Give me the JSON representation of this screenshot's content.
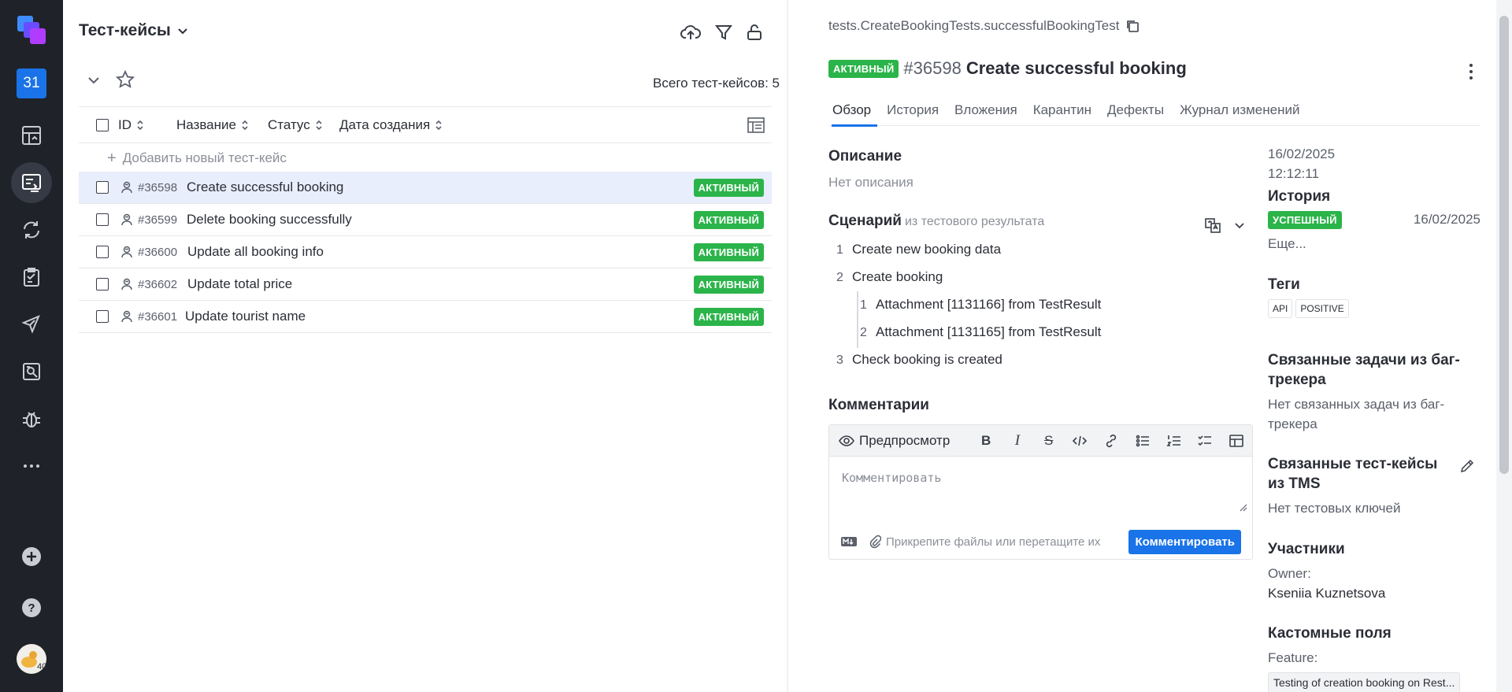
{
  "rail": {
    "project_label": "31",
    "nav_icons": [
      "dashboard-icon",
      "test-cases-icon",
      "launches-icon",
      "test-plans-icon",
      "jobs-icon",
      "analytics-icon",
      "defects-icon",
      "more-icon"
    ],
    "bottom_icons": [
      "add-project-icon",
      "help-icon",
      "avatar"
    ],
    "avatar_badge": "40"
  },
  "list": {
    "title": "Тест-кейсы",
    "total_label": "Всего тест-кейсов: 5",
    "columns": [
      "ID",
      "Название",
      "Статус",
      "Дата создания"
    ],
    "add_label": "Добавить новый тест-кейс",
    "rows": [
      {
        "id": "#36598",
        "name": "Create successful booking",
        "status": "АКТИВНЫЙ",
        "selected": true
      },
      {
        "id": "#36599",
        "name": "Delete booking successfully",
        "status": "АКТИВНЫЙ"
      },
      {
        "id": "#36600",
        "name": "Update all booking info",
        "status": "АКТИВНЫЙ"
      },
      {
        "id": "#36602",
        "name": "Update total price",
        "status": "АКТИВНЫЙ"
      },
      {
        "id": "#36601",
        "name": "Update tourist name",
        "status": "АКТИВНЫЙ"
      }
    ]
  },
  "detail": {
    "path": "tests.CreateBookingTests.successfulBookingTest",
    "status": "АКТИВНЫЙ",
    "number": "#36598",
    "title": "Create successful booking",
    "tabs": [
      "Обзор",
      "История",
      "Вложения",
      "Карантин",
      "Дефекты",
      "Журнал изменений"
    ],
    "description_heading": "Описание",
    "description_text": "Нет описания",
    "scenario_heading": "Сценарий",
    "scenario_sub": "из тестового результата",
    "steps": [
      {
        "n": "1",
        "text": "Create new booking data"
      },
      {
        "n": "2",
        "text": "Create booking"
      },
      {
        "n": "3",
        "text": "Check booking is created"
      }
    ],
    "substeps": [
      {
        "n": "1",
        "text": "Attachment [1131166] from TestResult"
      },
      {
        "n": "2",
        "text": "Attachment [1131165] from TestResult"
      }
    ],
    "comments_heading": "Комментарии",
    "editor": {
      "preview_label": "Предпросмотр",
      "tools": [
        "B",
        "I",
        "S"
      ],
      "placeholder": "Комментировать",
      "attach_label": "Прикрепите файлы или перетащите их",
      "submit_label": "Комментировать"
    }
  },
  "meta": {
    "date": "16/02/2025",
    "time": "12:12:11",
    "history_heading": "История",
    "history_status": "УСПЕШНЫЙ",
    "history_date": "16/02/2025",
    "history_more": "Еще...",
    "tags_heading": "Теги",
    "tags": [
      "API",
      "POSITIVE"
    ],
    "linked_issues_heading": "Связанные задачи из баг-трекера",
    "linked_issues_text": "Нет связанных задач из баг-трекера",
    "linked_tms_heading": "Связанные тест-кейсы из TMS",
    "linked_tms_text": "Нет тестовых ключей",
    "members_heading": "Участники",
    "owner_label": "Owner:",
    "owner_name": "Kseniia Kuznetsova",
    "custom_heading": "Кастомные поля",
    "feature_label": "Feature:",
    "feature_value": "Testing of creation booking on Rest..."
  },
  "colors": {
    "accent": "#1a73e8",
    "active_badge": "#2bb44a",
    "rail": "#1f2229",
    "selected_row": "#e8eefc"
  }
}
